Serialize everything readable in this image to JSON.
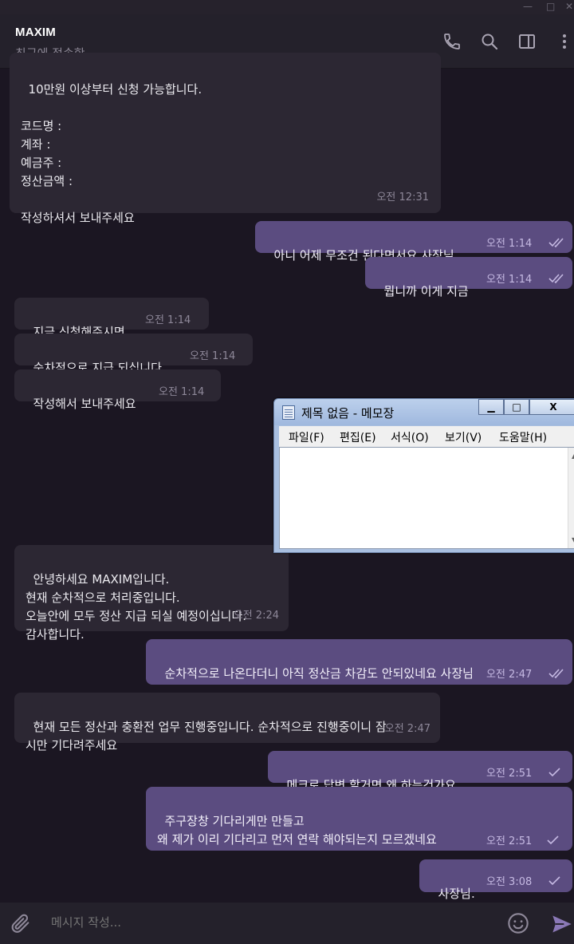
{
  "header": {
    "title": "MAXIM",
    "status": "최근에 접속함"
  },
  "messages": [
    {
      "dir": "in",
      "text": "10만원 이상부터 신청 가능합니다.\n\n코드명 :\n계좌 :\n예금주 :\n정산금액 :\n\n작성하셔서 보내주세요",
      "time": "오전 12:31"
    },
    {
      "dir": "out",
      "text": "아니 어제 무조건 된다면서요 사장님",
      "time": "오전 1:14",
      "read": true
    },
    {
      "dir": "out",
      "text": "뭡니까 이게 지금",
      "time": "오전 1:14",
      "read": true
    },
    {
      "dir": "in",
      "text": "지금 신청해주시면",
      "time": "오전 1:14"
    },
    {
      "dir": "in",
      "text": "순차적으로 지급 되십니다.",
      "time": "오전 1:14"
    },
    {
      "dir": "in",
      "text": "작성해서 보내주세요",
      "time": "오전 1:14"
    },
    {
      "dir": "in",
      "text": "안녕하세요 MAXIM입니다.\n현재 순차적으로 처리중입니다.\n오늘안에 모두 정산 지급 되실 예정이십니다.\n감사합니다.",
      "time": "오전 2:24"
    },
    {
      "dir": "out",
      "text": "순차적으로 나온다더니 아직 정산금 차감도 안되있네요 사장님",
      "time": "오전 2:47",
      "read": true
    },
    {
      "dir": "in",
      "text": "현재 모든 정산과 충환전 업무 진행중입니다. 순차적으로 진행중이니 잠\n시만 기다려주세요",
      "time": "오전 2:47"
    },
    {
      "dir": "out",
      "text": "메크로 답변 할거면 왜 하는건가요",
      "time": "오전 2:51",
      "read": false
    },
    {
      "dir": "out",
      "text": "주구장창 기다리게만 만들고\n왜 제가 이리 기다리고 먼저 연락 해야되는지 모르겠네요",
      "time": "오전 2:51",
      "read": false
    },
    {
      "dir": "out",
      "text": "사장님.",
      "time": "오전 3:08",
      "read": false
    }
  ],
  "notepad": {
    "title": "제목 없음 - 메모장",
    "menus": [
      "파일(F)",
      "편집(E)",
      "서식(O)",
      "보기(V)",
      "도움말(H)"
    ],
    "buttons": [
      "▁",
      "□",
      "X"
    ]
  },
  "composer": {
    "placeholder": "메시지 작성..."
  }
}
